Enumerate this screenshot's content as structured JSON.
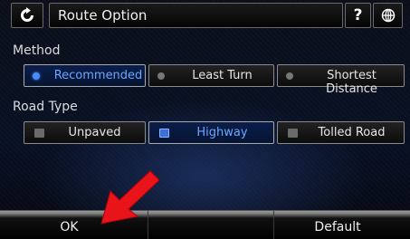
{
  "header": {
    "title": "Route Option",
    "back_icon": "refresh-back-icon",
    "help_label": "?",
    "language_icon": "globe-icon"
  },
  "method": {
    "label": "Method",
    "options": [
      {
        "label": "Recommended",
        "selected": true
      },
      {
        "label": "Least Turn",
        "selected": false
      },
      {
        "label": "Shortest Distance",
        "selected": false
      }
    ]
  },
  "road_type": {
    "label": "Road Type",
    "options": [
      {
        "label": "Unpaved",
        "checked": false
      },
      {
        "label": "Highway",
        "checked": true
      },
      {
        "label": "Tolled Road",
        "checked": false
      }
    ]
  },
  "footer": {
    "ok_label": "OK",
    "middle_label": "",
    "default_label": "Default"
  },
  "colors": {
    "selected_text": "#6aa7ff",
    "annotation_arrow": "#e8141a"
  }
}
